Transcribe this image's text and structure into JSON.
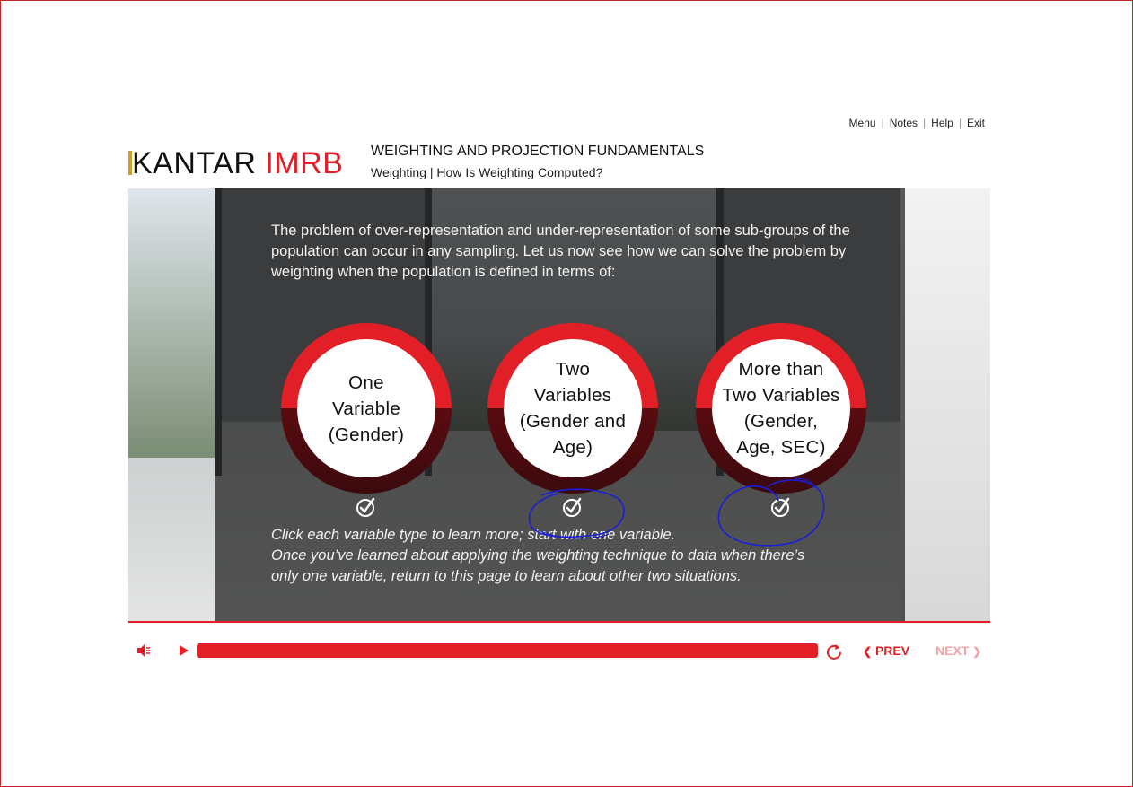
{
  "nav": {
    "menu": "Menu",
    "notes": "Notes",
    "help": "Help",
    "exit": "Exit",
    "separator": "|"
  },
  "logo": {
    "kantar": "KANTAR",
    "imrb": "IMRB"
  },
  "course": {
    "title": "WEIGHTING AND PROJECTION FUNDAMENTALS",
    "subtitle": "Weighting | How Is Weighting Computed?"
  },
  "content": {
    "intro": "The problem of over-representation and under-representation of some sub-groups of the population can occur in any sampling. Let us now see how we can solve the problem by weighting when the population is defined in terms of:",
    "options": [
      {
        "lines": [
          "One",
          "Variable",
          "(Gender)"
        ]
      },
      {
        "lines": [
          "Two",
          "Variables",
          "(Gender and",
          "Age)"
        ]
      },
      {
        "lines": [
          "More than",
          "Two Variables",
          "(Gender,",
          "Age, SEC)"
        ]
      }
    ],
    "instruction_1": "Click each variable type to learn more; start with one variable.",
    "instruction_2": "Once you’ve learned about applying the weighting technique to data when there’s",
    "instruction_3": "only one variable, return to this page to learn about other two situations."
  },
  "controls": {
    "prev": "PREV",
    "next": "NEXT",
    "progress_fraction": 1.0
  },
  "colors": {
    "accent": "#e21e26",
    "annotation": "#1a1fd6"
  },
  "icons": [
    "volume-icon",
    "play-icon",
    "replay-icon",
    "chevron-left-icon",
    "chevron-right-icon",
    "check-circle-icon"
  ]
}
